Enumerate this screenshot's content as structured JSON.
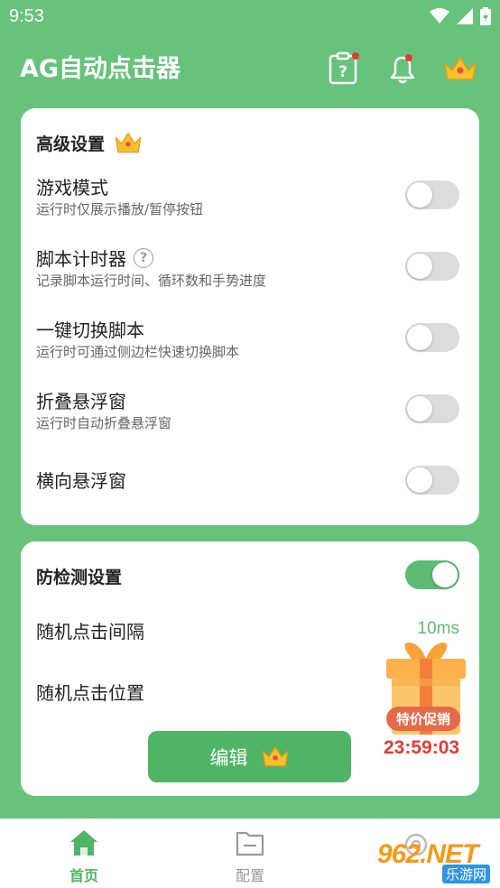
{
  "status_bar": {
    "time": "9:53"
  },
  "header": {
    "title": "AG自动点击器"
  },
  "advanced": {
    "title": "高级设置",
    "rows": [
      {
        "title": "游戏模式",
        "desc": "运行时仅展示播放/暂停按钮",
        "enabled": false
      },
      {
        "title": "脚本计时器",
        "desc": "记录脚本运行时间、循环数和手势进度",
        "enabled": false
      },
      {
        "title": "一键切换脚本",
        "desc": "运行时可通过侧边栏快速切换脚本",
        "enabled": false
      },
      {
        "title": "折叠悬浮窗",
        "desc": "运行时自动折叠悬浮窗",
        "enabled": false
      },
      {
        "title": "横向悬浮窗",
        "desc": "",
        "enabled": false
      }
    ]
  },
  "anti_detect": {
    "title": "防检测设置",
    "enabled": true,
    "interval_label": "随机点击间隔",
    "interval_value": "10ms",
    "position_label": "随机点击位置",
    "edit_label": "编辑"
  },
  "promo": {
    "label": "特价促销",
    "timer": "23:59:03"
  },
  "bottom_nav": {
    "home_label": "首页",
    "config_label": "配置"
  },
  "watermark": {
    "main": "962.NET",
    "sub": "乐游网"
  },
  "colors": {
    "primary": "#67c27c",
    "accent": "#4fb466",
    "alert": "#e53935"
  },
  "icons": [
    "help-clipboard-icon",
    "bell-icon",
    "crown-icon",
    "home-icon",
    "folder-icon"
  ]
}
